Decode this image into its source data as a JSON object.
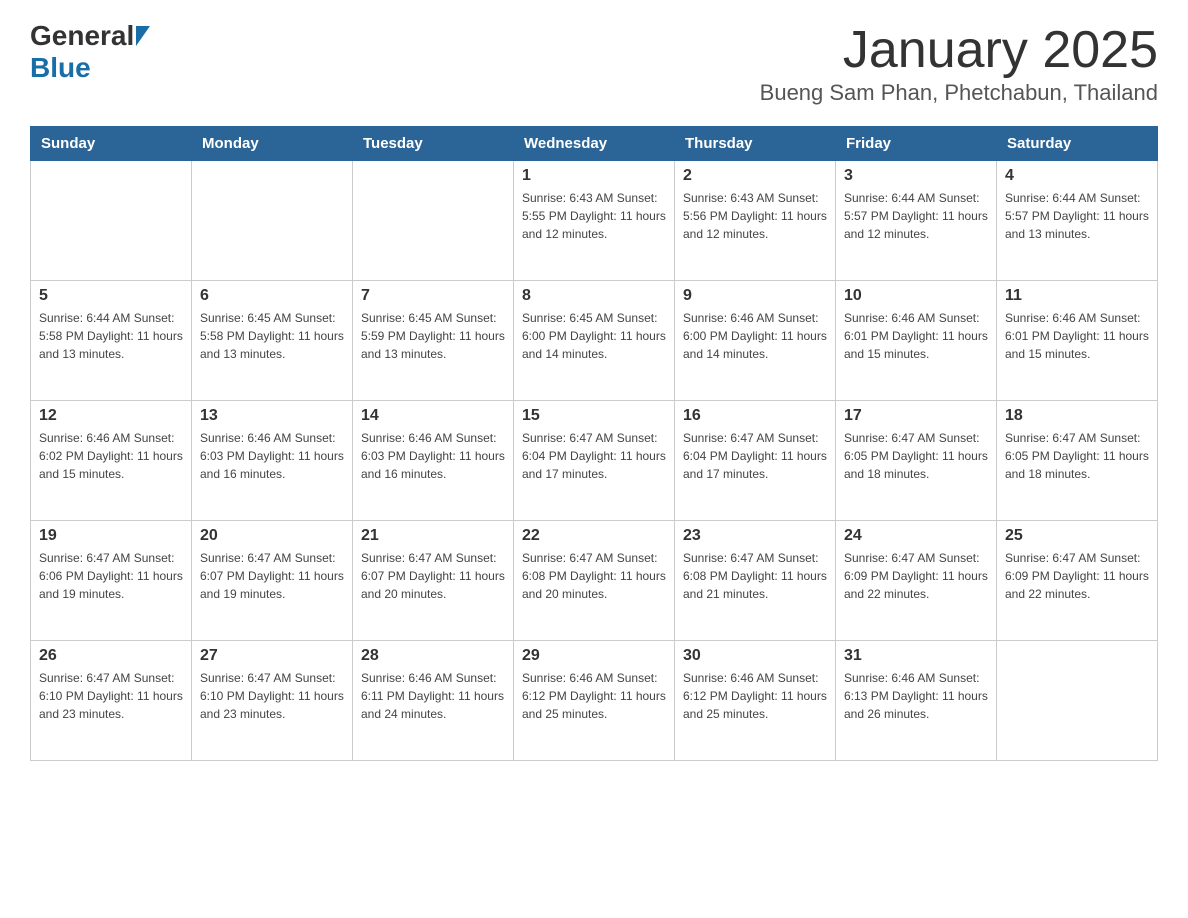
{
  "header": {
    "logo_general": "General",
    "logo_blue": "Blue",
    "month_title": "January 2025",
    "location": "Bueng Sam Phan, Phetchabun, Thailand"
  },
  "calendar": {
    "days": [
      "Sunday",
      "Monday",
      "Tuesday",
      "Wednesday",
      "Thursday",
      "Friday",
      "Saturday"
    ],
    "weeks": [
      [
        {
          "day": "",
          "info": ""
        },
        {
          "day": "",
          "info": ""
        },
        {
          "day": "",
          "info": ""
        },
        {
          "day": "1",
          "info": "Sunrise: 6:43 AM\nSunset: 5:55 PM\nDaylight: 11 hours\nand 12 minutes."
        },
        {
          "day": "2",
          "info": "Sunrise: 6:43 AM\nSunset: 5:56 PM\nDaylight: 11 hours\nand 12 minutes."
        },
        {
          "day": "3",
          "info": "Sunrise: 6:44 AM\nSunset: 5:57 PM\nDaylight: 11 hours\nand 12 minutes."
        },
        {
          "day": "4",
          "info": "Sunrise: 6:44 AM\nSunset: 5:57 PM\nDaylight: 11 hours\nand 13 minutes."
        }
      ],
      [
        {
          "day": "5",
          "info": "Sunrise: 6:44 AM\nSunset: 5:58 PM\nDaylight: 11 hours\nand 13 minutes."
        },
        {
          "day": "6",
          "info": "Sunrise: 6:45 AM\nSunset: 5:58 PM\nDaylight: 11 hours\nand 13 minutes."
        },
        {
          "day": "7",
          "info": "Sunrise: 6:45 AM\nSunset: 5:59 PM\nDaylight: 11 hours\nand 13 minutes."
        },
        {
          "day": "8",
          "info": "Sunrise: 6:45 AM\nSunset: 6:00 PM\nDaylight: 11 hours\nand 14 minutes."
        },
        {
          "day": "9",
          "info": "Sunrise: 6:46 AM\nSunset: 6:00 PM\nDaylight: 11 hours\nand 14 minutes."
        },
        {
          "day": "10",
          "info": "Sunrise: 6:46 AM\nSunset: 6:01 PM\nDaylight: 11 hours\nand 15 minutes."
        },
        {
          "day": "11",
          "info": "Sunrise: 6:46 AM\nSunset: 6:01 PM\nDaylight: 11 hours\nand 15 minutes."
        }
      ],
      [
        {
          "day": "12",
          "info": "Sunrise: 6:46 AM\nSunset: 6:02 PM\nDaylight: 11 hours\nand 15 minutes."
        },
        {
          "day": "13",
          "info": "Sunrise: 6:46 AM\nSunset: 6:03 PM\nDaylight: 11 hours\nand 16 minutes."
        },
        {
          "day": "14",
          "info": "Sunrise: 6:46 AM\nSunset: 6:03 PM\nDaylight: 11 hours\nand 16 minutes."
        },
        {
          "day": "15",
          "info": "Sunrise: 6:47 AM\nSunset: 6:04 PM\nDaylight: 11 hours\nand 17 minutes."
        },
        {
          "day": "16",
          "info": "Sunrise: 6:47 AM\nSunset: 6:04 PM\nDaylight: 11 hours\nand 17 minutes."
        },
        {
          "day": "17",
          "info": "Sunrise: 6:47 AM\nSunset: 6:05 PM\nDaylight: 11 hours\nand 18 minutes."
        },
        {
          "day": "18",
          "info": "Sunrise: 6:47 AM\nSunset: 6:05 PM\nDaylight: 11 hours\nand 18 minutes."
        }
      ],
      [
        {
          "day": "19",
          "info": "Sunrise: 6:47 AM\nSunset: 6:06 PM\nDaylight: 11 hours\nand 19 minutes."
        },
        {
          "day": "20",
          "info": "Sunrise: 6:47 AM\nSunset: 6:07 PM\nDaylight: 11 hours\nand 19 minutes."
        },
        {
          "day": "21",
          "info": "Sunrise: 6:47 AM\nSunset: 6:07 PM\nDaylight: 11 hours\nand 20 minutes."
        },
        {
          "day": "22",
          "info": "Sunrise: 6:47 AM\nSunset: 6:08 PM\nDaylight: 11 hours\nand 20 minutes."
        },
        {
          "day": "23",
          "info": "Sunrise: 6:47 AM\nSunset: 6:08 PM\nDaylight: 11 hours\nand 21 minutes."
        },
        {
          "day": "24",
          "info": "Sunrise: 6:47 AM\nSunset: 6:09 PM\nDaylight: 11 hours\nand 22 minutes."
        },
        {
          "day": "25",
          "info": "Sunrise: 6:47 AM\nSunset: 6:09 PM\nDaylight: 11 hours\nand 22 minutes."
        }
      ],
      [
        {
          "day": "26",
          "info": "Sunrise: 6:47 AM\nSunset: 6:10 PM\nDaylight: 11 hours\nand 23 minutes."
        },
        {
          "day": "27",
          "info": "Sunrise: 6:47 AM\nSunset: 6:10 PM\nDaylight: 11 hours\nand 23 minutes."
        },
        {
          "day": "28",
          "info": "Sunrise: 6:46 AM\nSunset: 6:11 PM\nDaylight: 11 hours\nand 24 minutes."
        },
        {
          "day": "29",
          "info": "Sunrise: 6:46 AM\nSunset: 6:12 PM\nDaylight: 11 hours\nand 25 minutes."
        },
        {
          "day": "30",
          "info": "Sunrise: 6:46 AM\nSunset: 6:12 PM\nDaylight: 11 hours\nand 25 minutes."
        },
        {
          "day": "31",
          "info": "Sunrise: 6:46 AM\nSunset: 6:13 PM\nDaylight: 11 hours\nand 26 minutes."
        },
        {
          "day": "",
          "info": ""
        }
      ]
    ]
  }
}
